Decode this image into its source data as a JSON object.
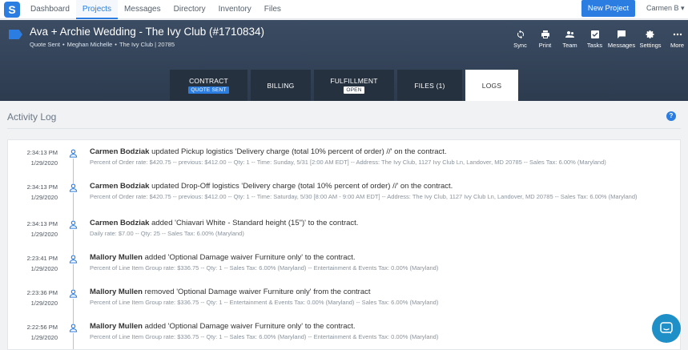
{
  "nav": {
    "logo_letter": "S",
    "links": [
      "Dashboard",
      "Projects",
      "Messages",
      "Directory",
      "Inventory",
      "Files"
    ],
    "active_index": 1,
    "new_project": "New Project",
    "user": "Carmen B ▾"
  },
  "project": {
    "title": "Ava + Archie Wedding - The Ivy Club (#1710834)",
    "status": "Quote Sent",
    "client": "Meghan Michelle",
    "venue": "The Ivy Club | 20785"
  },
  "actions": [
    {
      "label": "Sync",
      "icon": "sync-icon"
    },
    {
      "label": "Print",
      "icon": "print-icon"
    },
    {
      "label": "Team",
      "icon": "team-icon"
    },
    {
      "label": "Tasks",
      "icon": "tasks-icon"
    },
    {
      "label": "Messages",
      "icon": "messages-icon"
    },
    {
      "label": "Settings",
      "icon": "settings-icon"
    },
    {
      "label": "More",
      "icon": "more-icon"
    }
  ],
  "tabs": [
    {
      "label": "CONTRACT",
      "badge": "QUOTE SENT"
    },
    {
      "label": "BILLING",
      "badge": ""
    },
    {
      "label": "FULFILLMENT",
      "badge": "OPEN"
    },
    {
      "label": "FILES (1)",
      "badge": ""
    },
    {
      "label": "LOGS",
      "badge": ""
    }
  ],
  "activity": {
    "title": "Activity Log",
    "help": "?",
    "entries": [
      {
        "time": "2:34:13 PM",
        "date": "1/29/2020",
        "user": "Carmen Bodziak",
        "action": " updated Pickup logistics 'Delivery charge (total 10% percent of order) //' on the contract.",
        "detail": "Percent of Order rate: $420.75 -- previous: $412.00 -- Qty: 1 -- Time: Sunday, 5/31 [2:00 AM EDT] -- Address: The Ivy Club, 1127 Ivy Club Ln, Landover, MD 20785 -- Sales Tax: 6.00% (Maryland)"
      },
      {
        "time": "2:34:13 PM",
        "date": "1/29/2020",
        "user": "Carmen Bodziak",
        "action": " updated Drop-Off logistics 'Delivery charge (total 10% percent of order) //' on the contract.",
        "detail": "Percent of Order rate: $420.75 -- previous: $412.00 -- Qty: 1 -- Time: Saturday, 5/30 [8:00 AM - 9:00 AM EDT] -- Address: The Ivy Club, 1127 Ivy Club Ln, Landover, MD 20785 -- Sales Tax: 6.00% (Maryland)"
      },
      {
        "time": "2:34:13 PM",
        "date": "1/29/2020",
        "user": "Carmen Bodziak",
        "action": " added 'Chiavari White - Standard height (15\")' to the contract.",
        "detail": "Daily rate: $7.00 -- Qty: 25 -- Sales Tax: 6.00% (Maryland)"
      },
      {
        "time": "2:23:41 PM",
        "date": "1/29/2020",
        "user": "Mallory Mullen",
        "action": " added 'Optional Damage waiver Furniture only' to the contract.",
        "detail": "Percent of Line Item Group rate: $336.75 -- Qty: 1 -- Sales Tax: 6.00% (Maryland) -- Entertainment & Events Tax: 0.00% (Maryland)"
      },
      {
        "time": "2:23:36 PM",
        "date": "1/29/2020",
        "user": "Mallory Mullen",
        "action": " removed 'Optional Damage waiver Furniture only' from the contract",
        "detail": "Percent of Line Item Group rate: $336.75 -- Qty: 1 -- Entertainment & Events Tax: 0.00% (Maryland) -- Sales Tax: 6.00% (Maryland)"
      },
      {
        "time": "2:22:56 PM",
        "date": "1/29/2020",
        "user": "Mallory Mullen",
        "action": " added 'Optional Damage waiver Furniture only' to the contract.",
        "detail": "Percent of Line Item Group rate: $336.75 -- Qty: 1 -- Sales Tax: 6.00% (Maryland) -- Entertainment & Events Tax: 0.00% (Maryland)"
      }
    ]
  }
}
